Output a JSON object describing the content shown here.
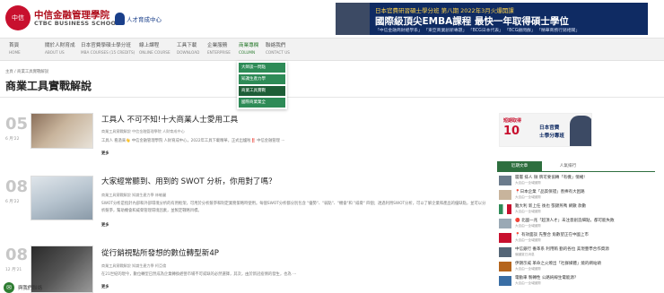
{
  "header": {
    "logo_badge": "中信",
    "logo_cn": "中信金融管理學院",
    "logo_en": "CTBC BUSINESS SCHOOL",
    "sub_logo": "人才育成中心",
    "banner": {
      "top_line": "日本官費研習碩士學分班 第八期 2022年3月火爆開課",
      "main_line": "國際級頂尖EMBA課程  最快一年取得碩士學位",
      "tags": "「中信金融商財經學系」 「東亞商業創新專題」 「BCG日本代表」 「BCG顧問群」 「精華商務行銷相關」"
    }
  },
  "nav": [
    {
      "zh": "首頁",
      "en": "HOME"
    },
    {
      "zh": "關於人財育成",
      "en": "ABOUT US"
    },
    {
      "zh": "日本官費學碩士學分班",
      "en": "MBA COURSES (15 CREDITS)"
    },
    {
      "zh": "線上課程",
      "en": "ONLINE COURSE"
    },
    {
      "zh": "工具下載",
      "en": "DOWNLOAD"
    },
    {
      "zh": "企業服務",
      "en": "ENTERPRISE"
    },
    {
      "zh": "商業專欄",
      "en": "COLUMN"
    },
    {
      "zh": "聯絡我們",
      "en": "CONTACT US"
    }
  ],
  "dropdown": [
    "大師談一問點",
    "知識生產力學",
    "商業工具實戰",
    "國際商業業全"
  ],
  "breadcrumb": "主頁 / 商業工具實戰解說",
  "page_title": "商業工具實戰解說",
  "articles": [
    {
      "day": "05",
      "month": "6 月'22",
      "title": "工具人 不可不知!十大商業人士愛用工具",
      "meta": "商業工具實戰解說  中信金融管理學院 人財育成中心",
      "excerpt": "工具人 看過來👋 中信金融管理學院 人財育成中心，2022年工具下載精華，正式出爐啦‼️ 中信金融管理 ···",
      "more": "更多"
    },
    {
      "day": "08",
      "month": "6 月'22",
      "title": "大家經常聽到、用到的 SWOT 分析，你用對了嗎？",
      "meta": "商業工具實戰解說  知識生產力學  林敏麗",
      "excerpt": "SWOT分析是指針內部和外部環境分析的有用框架，可用於分析競爭和制定業務策略時使用。每個SWOT分析都分別包含 \"優勢\"、\"弱點\"、\"機會\"和 \"威脅\" 四個；透過利用SWOT分析，可以了解企業和產品的優缺點，並可以分析競爭，幫助機會和威脅管理環境因素，並製定戰略目標。",
      "more": "更多"
    },
    {
      "day": "08",
      "month": "12 月'21",
      "title": "從行銷視點所發想的數位轉型新4P",
      "meta": "商業工具實戰解說  知識生產力學  柯亞倫",
      "excerpt": "在21世紀的現今，數位轉型已然成為企業轉換經營市場不可或缺的必然選擇，其次，由於新冠疫情的發生，也為 ···",
      "more": "更多"
    }
  ],
  "side_ad": {
    "line1": "短期取得",
    "line2": "10",
    "line3a": "日本官費",
    "line3b": "士學分專班"
  },
  "side_tabs": [
    "近期文章",
    "人氣排行"
  ],
  "side_items": [
    {
      "title": "層層 排人 微 牌可要協轉「有機」情緒!",
      "src": "大自由一全域國際"
    },
    {
      "title": "📍日本企業「品質保證」善捧有大困路",
      "src": "大自由一全域國際"
    },
    {
      "title": "難大利 新上任 後也 張錦燕嗎 網數 款數",
      "src": "大自由一全域國際"
    },
    {
      "title": "🔴 北國一兆「超頂人才」未注意創造細點，都可能失敗",
      "src": "大自由一全域國際"
    },
    {
      "title": "📍 有效面談 先整合 角數望正在中國上市",
      "src": "大自由一全域國際"
    },
    {
      "title": "中信銀行 養革系 利用賄 勤的各拉 美現豐學合作資源",
      "src": "偏國夏日消息"
    },
    {
      "title": "伊朗示威 革命之火燎出「社群媒體」燒的網站頭",
      "src": "大自由一全域國際"
    },
    {
      "title": "電動車 製轉性 公路純線生電能源？",
      "src": "大自由一全域國際"
    }
  ],
  "chat_label": "與我們聯絡",
  "colors": {
    "brand_red": "#c8102e",
    "accent_green": "#2e7d32",
    "banner_navy": "#0f2b63"
  }
}
